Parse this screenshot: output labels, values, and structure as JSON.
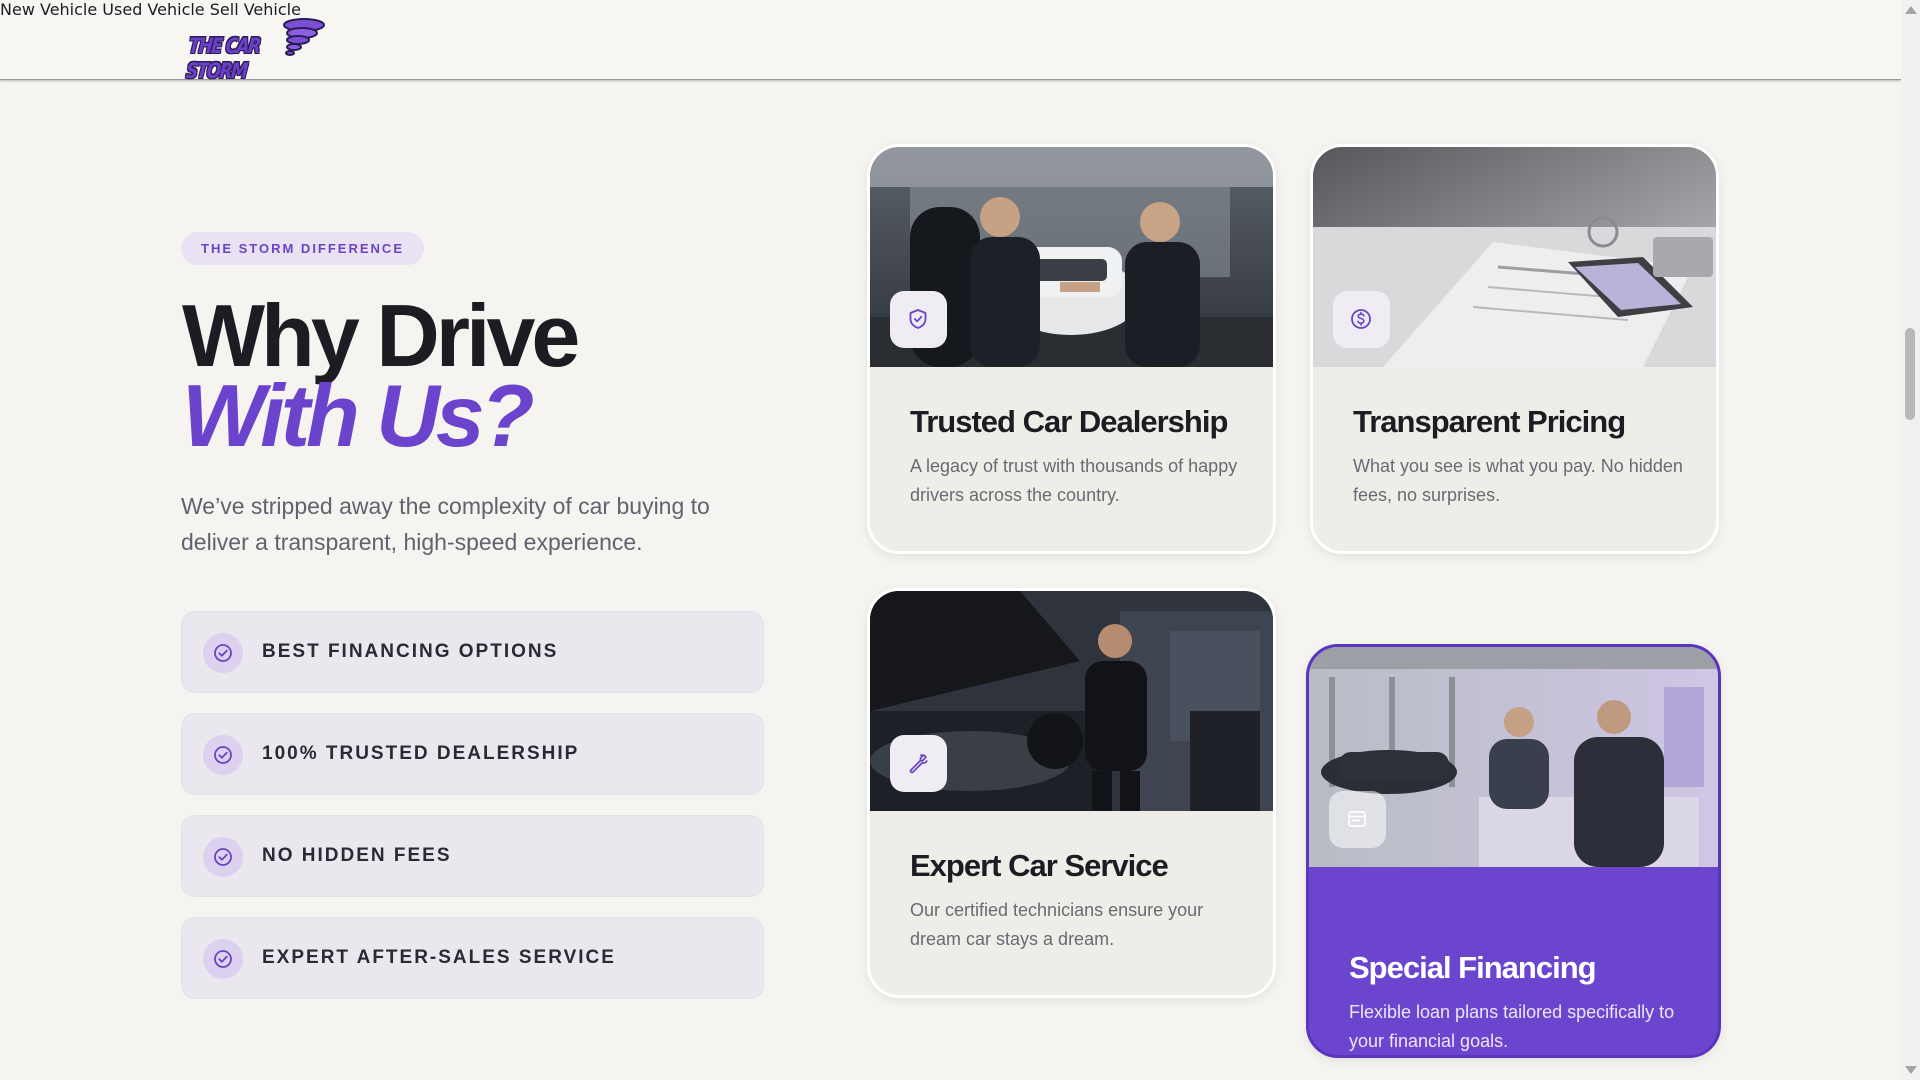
{
  "header": {
    "logo_text": "THE CAR STORM",
    "nav": [
      "New Vehicle",
      "Used Vehicle",
      "Sell Vehicle"
    ]
  },
  "section": {
    "badge": "THE STORM DIFFERENCE",
    "headline_line1": "Why Drive",
    "headline_line2": "With Us?",
    "intro": "We’ve stripped away the complexity of car buying to deliver a transparent, high-speed experience.",
    "features": [
      "BEST FINANCING OPTIONS",
      "100% TRUSTED DEALERSHIP",
      "NO HIDDEN FEES",
      "EXPERT AFTER-SALES SERVICE"
    ]
  },
  "cards": [
    {
      "title": "Trusted Car Dealership",
      "description": "A legacy of trust with thousands of happy drivers across the country.",
      "icon": "shield-check-icon"
    },
    {
      "title": "Transparent Pricing",
      "description": "What you see is what you pay. No hidden fees, no surprises.",
      "icon": "dollar-circle-icon"
    },
    {
      "title": "Expert Car Service",
      "description": "Our certified technicians ensure your dream car stays a dream.",
      "icon": "wrench-icon"
    },
    {
      "title": "Special Financing",
      "description": "Flexible loan plans tailored specifically to your financial goals.",
      "icon": "wallet-icon"
    }
  ],
  "colors": {
    "accent": "#6c45cf",
    "background": "#f5f4f0",
    "heading": "#1d1c22"
  }
}
